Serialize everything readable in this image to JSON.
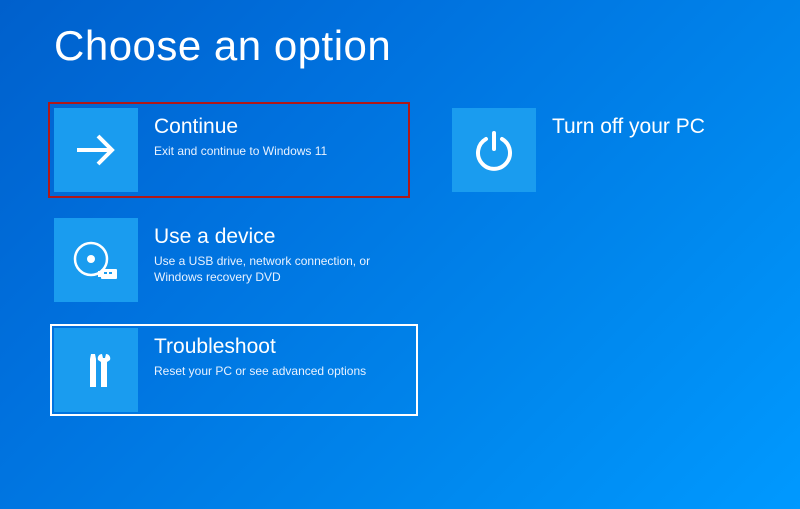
{
  "title": "Choose an option",
  "colors": {
    "tile_bg": "#1a9cef",
    "highlight_red": "#b01818",
    "highlight_white": "#ffffff"
  },
  "options": {
    "continue": {
      "title": "Continue",
      "desc": "Exit and continue to Windows 11",
      "icon": "arrow-right-icon",
      "highlighted": "red"
    },
    "use_device": {
      "title": "Use a device",
      "desc": "Use a USB drive, network connection, or Windows recovery DVD",
      "icon": "disc-usb-icon",
      "highlighted": null
    },
    "troubleshoot": {
      "title": "Troubleshoot",
      "desc": "Reset your PC or see advanced options",
      "icon": "tools-icon",
      "highlighted": "white"
    },
    "turn_off": {
      "title": "Turn off your PC",
      "desc": "",
      "icon": "power-icon",
      "highlighted": null
    }
  }
}
